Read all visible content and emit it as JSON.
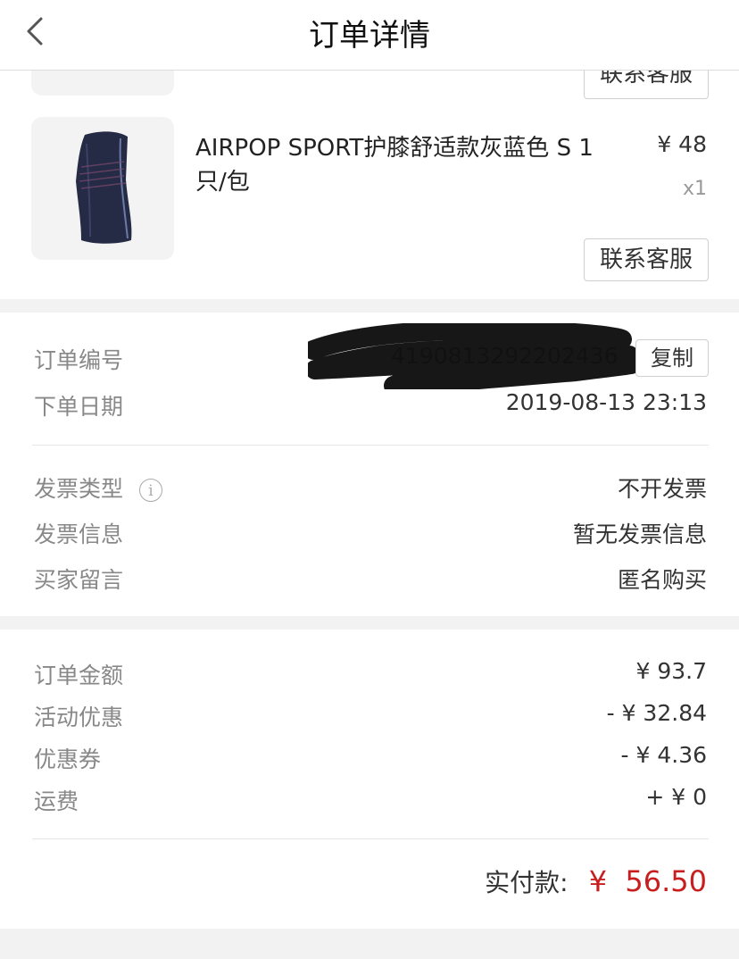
{
  "header": {
    "title": "订单详情"
  },
  "items": [
    {
      "contact_label": "联系客服"
    },
    {
      "name": "AIRPOP SPORT护膝舒适款灰蓝色 S 1只/包",
      "name_line1": "AIRPOP SPORT护膝舒适款灰蓝色 S 1",
      "name_line2": "只/包",
      "price": "¥ 48",
      "qty": "x1",
      "contact_label": "联系客服"
    }
  ],
  "order": {
    "number_label": "订单编号",
    "number_value": "4190813292202436",
    "copy_label": "复制",
    "date_label": "下单日期",
    "date_value": "2019-08-13 23:13"
  },
  "invoice": {
    "type_label": "发票类型",
    "type_value": "不开发票",
    "info_label": "发票信息",
    "info_value": "暂无发票信息",
    "message_label": "买家留言",
    "message_value": "匿名购买"
  },
  "amounts": {
    "order_amount_label": "订单金额",
    "order_amount_value": "¥ 93.7",
    "promo_label": "活动优惠",
    "promo_value": "- ¥ 32.84",
    "coupon_label": "优惠券",
    "coupon_value": "- ¥ 4.36",
    "shipping_label": "运费",
    "shipping_value": "+ ¥ 0",
    "paid_label": "实付款:",
    "paid_value": "¥  56.50"
  },
  "colors": {
    "accent": "#c81e1e",
    "muted": "#888888",
    "section_bg": "#f2f2f2"
  }
}
